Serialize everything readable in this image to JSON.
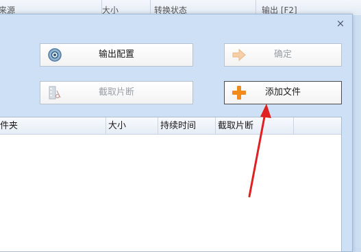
{
  "background_table": {
    "columns": [
      "来源",
      "大小",
      "转换状态",
      "输出 [F2]"
    ]
  },
  "dialog": {
    "close_icon": "×",
    "buttons": {
      "output_config": "输出配置",
      "confirm": "确定",
      "clip": "截取片断",
      "add_file": "添加文件"
    }
  },
  "file_list": {
    "columns": [
      "件夹",
      "大小",
      "持续时间",
      "截取片断",
      ""
    ]
  },
  "colors": {
    "dialog_bg": "#cde0f5",
    "annotation_arrow": "#e02020",
    "add_icon": "#f08a1c"
  }
}
